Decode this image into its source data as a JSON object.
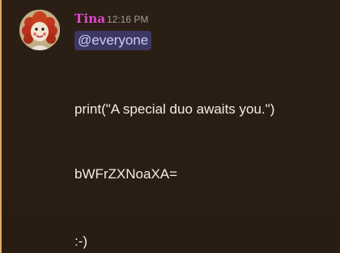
{
  "message": {
    "author": "Tina",
    "timestamp": "12:16 PM",
    "mention": "@everyone",
    "lines": [
      "print(\"A special duo awaits you.\")",
      "bWFrZXNoaXA=",
      ":-)"
    ]
  },
  "colors": {
    "author": "#e04ad0",
    "mention_bg": "#3d3762",
    "mention_text": "#c9cdfb",
    "mention_bar": "#e0a95a",
    "background": "#2b1f15"
  },
  "icons": {
    "avatar": "rag-doll-avatar"
  }
}
